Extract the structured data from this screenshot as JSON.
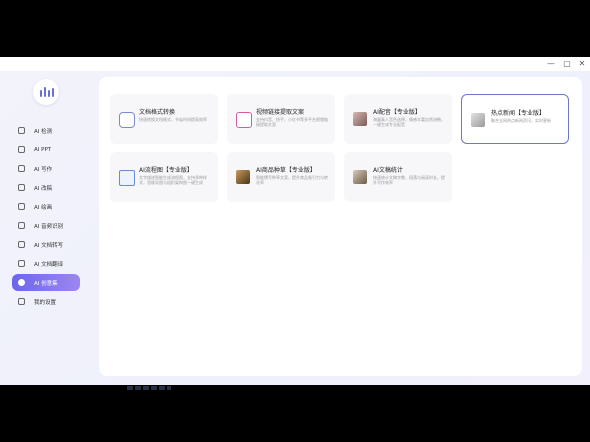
{
  "window": {
    "controls": {
      "minimize": "—",
      "maximize": "▢",
      "close": "✕"
    }
  },
  "sidebar": {
    "items": [
      {
        "label": "AI 检测",
        "icon": "search-doc-icon"
      },
      {
        "label": "AI PPT",
        "icon": "ppt-icon"
      },
      {
        "label": "AI 写作",
        "icon": "pen-icon"
      },
      {
        "label": "AI 改稿",
        "icon": "edit-icon"
      },
      {
        "label": "AI 绘画",
        "icon": "paint-icon"
      },
      {
        "label": "AI 音频识别",
        "icon": "audio-icon"
      },
      {
        "label": "AI 文档转写",
        "icon": "transcribe-icon"
      },
      {
        "label": "AI 文档翻译",
        "icon": "translate-icon"
      },
      {
        "label": "AI 创意集",
        "icon": "idea-icon",
        "active": true
      },
      {
        "label": "我的设置",
        "icon": "settings-icon"
      }
    ]
  },
  "cards": [
    {
      "title": "文档格式转换",
      "desc": "快速转换文档格式，节省时间提高效率",
      "thumb": "convert-icon"
    },
    {
      "title": "视频链接提取文案",
      "desc": "支持抖音、快手、小红书等多平台视频链接提取文案",
      "thumb": "video-icon"
    },
    {
      "title": "AI配音【专业版】",
      "desc": "海量真人音色选择，情感丰富自然流畅，一键生成专业配音",
      "thumb": "voice-photo"
    },
    {
      "title": "热点新闻【专业版】",
      "desc": "聚合全网热点新闻资讯，实时更新",
      "thumb": "news-photo"
    },
    {
      "title": "AI流程图【专业版】",
      "desc": "文字描述智能生成流程图，支持多种样式，思维导图与组织架构图一键生成",
      "thumb": "flowchart-icon"
    },
    {
      "title": "AI商品种草【专业版】",
      "desc": "智能撰写种草文案，提升商品吸引力与转化率",
      "thumb": "product-photo"
    },
    {
      "title": "AI文稿统计",
      "desc": "快速统计文稿字数、段落与阅读时长，提升写作效率",
      "thumb": "stats-photo"
    }
  ]
}
